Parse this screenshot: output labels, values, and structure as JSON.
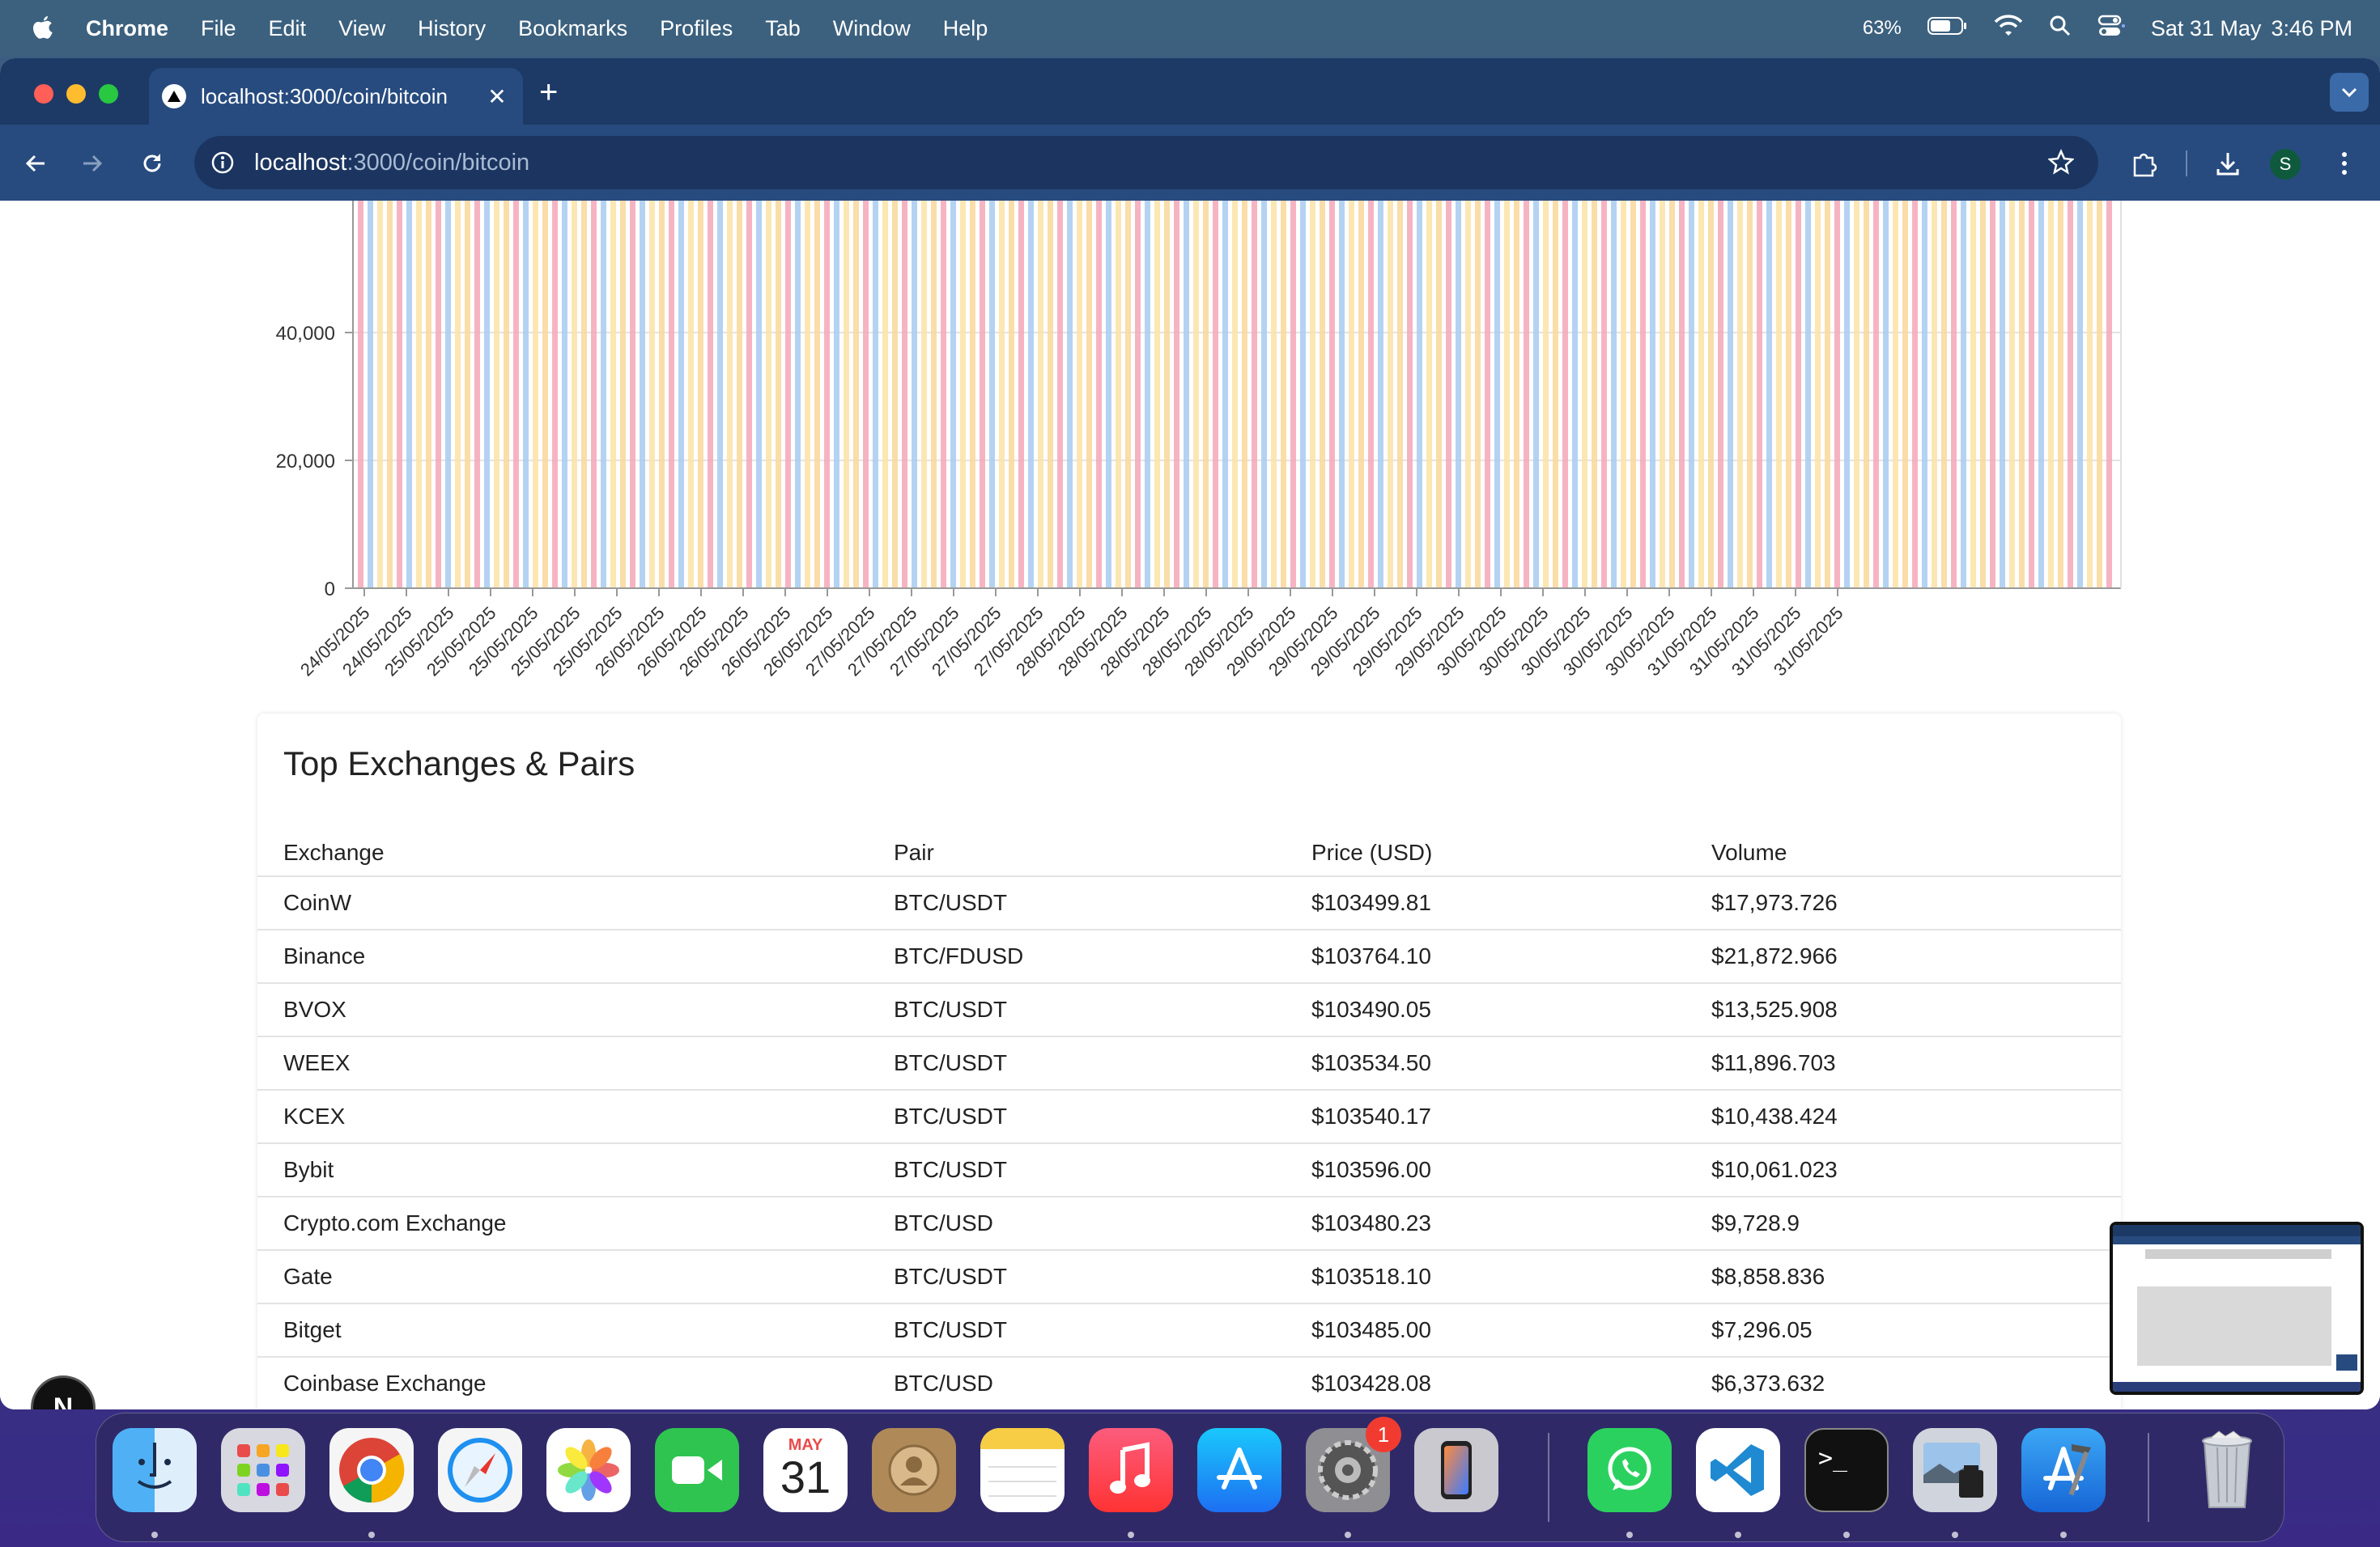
{
  "menubar": {
    "app_name": "Chrome",
    "menus": [
      "File",
      "Edit",
      "View",
      "History",
      "Bookmarks",
      "Profiles",
      "Tab",
      "Window",
      "Help"
    ],
    "battery": "63%",
    "date": "Sat 31 May",
    "time": "3:46 PM"
  },
  "browser": {
    "tab_title": "localhost:3000/coin/bitcoin",
    "url_host": "localhost",
    "url_path": ":3000/coin/bitcoin",
    "profile_initial": "S"
  },
  "chart_data": {
    "type": "bar",
    "xlabel": "",
    "ylabel": "",
    "ylim_visible": [
      0,
      50000
    ],
    "yticks": [
      0,
      20000,
      40000
    ],
    "ytick_labels": [
      "0",
      "20,000",
      "40,000"
    ],
    "xtick_labels": [
      "24/05/2025",
      "24/05/2025",
      "25/05/2025",
      "25/05/2025",
      "25/05/2025",
      "25/05/2025",
      "25/05/2025",
      "26/05/2025",
      "26/05/2025",
      "26/05/2025",
      "26/05/2025",
      "26/05/2025",
      "27/05/2025",
      "27/05/2025",
      "27/05/2025",
      "27/05/2025",
      "27/05/2025",
      "28/05/2025",
      "28/05/2025",
      "28/05/2025",
      "28/05/2025",
      "28/05/2025",
      "29/05/2025",
      "29/05/2025",
      "29/05/2025",
      "29/05/2025",
      "29/05/2025",
      "30/05/2025",
      "30/05/2025",
      "30/05/2025",
      "30/05/2025",
      "30/05/2025",
      "31/05/2025",
      "31/05/2025",
      "31/05/2025",
      "31/05/2025"
    ],
    "bars_per_label": 4,
    "bar_colors": [
      "#f4a7b9",
      "#a7cbf0",
      "#fbe3a6",
      "#f9d79a"
    ],
    "note_values": "all bars extend above the visible top of the chart area (> 50,000)",
    "grid": true
  },
  "exchanges": {
    "title": "Top Exchanges & Pairs",
    "columns": [
      "Exchange",
      "Pair",
      "Price (USD)",
      "Volume"
    ],
    "rows": [
      [
        "CoinW",
        "BTC/USDT",
        "$103499.81",
        "$17,973.726"
      ],
      [
        "Binance",
        "BTC/FDUSD",
        "$103764.10",
        "$21,872.966"
      ],
      [
        "BVOX",
        "BTC/USDT",
        "$103490.05",
        "$13,525.908"
      ],
      [
        "WEEX",
        "BTC/USDT",
        "$103534.50",
        "$11,896.703"
      ],
      [
        "KCEX",
        "BTC/USDT",
        "$103540.17",
        "$10,438.424"
      ],
      [
        "Bybit",
        "BTC/USDT",
        "$103596.00",
        "$10,061.023"
      ],
      [
        "Crypto.com Exchange",
        "BTC/USD",
        "$103480.23",
        "$9,728.9"
      ],
      [
        "Gate",
        "BTC/USDT",
        "$103518.10",
        "$8,858.836"
      ],
      [
        "Bitget",
        "BTC/USDT",
        "$103485.00",
        "$7,296.05"
      ],
      [
        "Coinbase Exchange",
        "BTC/USD",
        "$103428.08",
        "$6,373.632"
      ]
    ]
  },
  "nextjs_badge": "N",
  "dock": {
    "calendar_month": "MAY",
    "calendar_day": "31",
    "settings_badge": "1",
    "apps": [
      "finder-icon",
      "launchpad-icon",
      "chrome-icon",
      "safari-icon",
      "photos-icon",
      "facetime-icon",
      "calendar-icon",
      "contacts-icon",
      "notes-icon",
      "music-icon",
      "app-store-icon",
      "system-settings-icon",
      "iphone-mirroring-icon",
      "whatsapp-icon",
      "vscode-icon",
      "terminal-icon",
      "preview-icon",
      "xcode-icon",
      "trash-icon"
    ]
  }
}
